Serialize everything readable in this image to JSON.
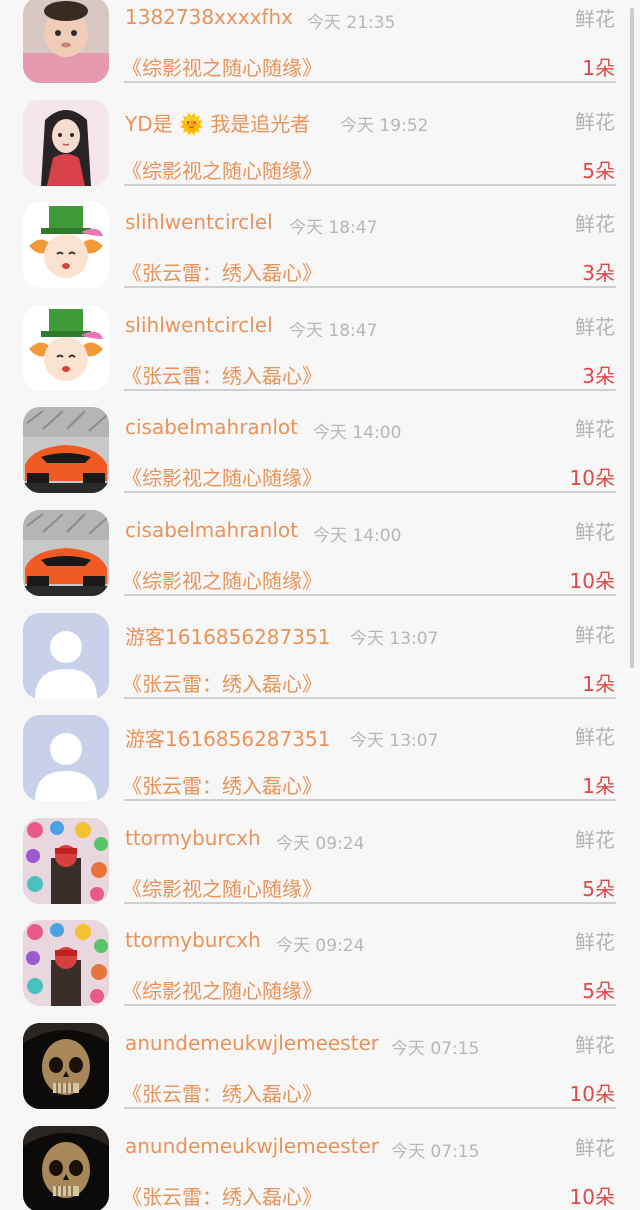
{
  "gift_records": [
    {
      "user": "1382738xxxxfhx",
      "time": "今天 21:35",
      "gift_type": "鲜花",
      "work": "《综影视之随心随缘》",
      "count": "1朵",
      "avatar": "baby-photo"
    },
    {
      "user": "YD是 🌞 我是追光者",
      "time": "今天 19:52",
      "gift_type": "鲜花",
      "work": "《综影视之随心随缘》",
      "count": "5朵",
      "avatar": "anime-girl"
    },
    {
      "user": "slihlwentcirclel",
      "time": "今天 18:47",
      "gift_type": "鲜花",
      "work": "《张云雷：绣入磊心》",
      "count": "3朵",
      "avatar": "cartoon-hatter"
    },
    {
      "user": "slihlwentcirclel",
      "time": "今天 18:47",
      "gift_type": "鲜花",
      "work": "《张云雷：绣入磊心》",
      "count": "3朵",
      "avatar": "cartoon-hatter"
    },
    {
      "user": "cisabelmahranlot",
      "time": "今天 14:00",
      "gift_type": "鲜花",
      "work": "《综影视之随心随缘》",
      "count": "10朵",
      "avatar": "orange-sports-car"
    },
    {
      "user": "cisabelmahranlot",
      "time": "今天 14:00",
      "gift_type": "鲜花",
      "work": "《综影视之随心随缘》",
      "count": "10朵",
      "avatar": "orange-sports-car"
    },
    {
      "user": "游客1616856287351",
      "time": "今天 13:07",
      "gift_type": "鲜花",
      "work": "《张云雷：绣入磊心》",
      "count": "1朵",
      "avatar": "default-silhouette"
    },
    {
      "user": "游客1616856287351",
      "time": "今天 13:07",
      "gift_type": "鲜花",
      "work": "《张云雷：绣入磊心》",
      "count": "1朵",
      "avatar": "default-silhouette"
    },
    {
      "user": "ttormyburcxh",
      "time": "今天 09:24",
      "gift_type": "鲜花",
      "work": "《综影视之随心随缘》",
      "count": "5朵",
      "avatar": "graffiti-hearts"
    },
    {
      "user": "ttormyburcxh",
      "time": "今天 09:24",
      "gift_type": "鲜花",
      "work": "《综影视之随心随缘》",
      "count": "5朵",
      "avatar": "graffiti-hearts"
    },
    {
      "user": "anundemeukwjlemeester",
      "time": "今天 07:15",
      "gift_type": "鲜花",
      "work": "《张云雷：绣入磊心》",
      "count": "10朵",
      "avatar": "skull"
    },
    {
      "user": "anundemeukwjlemeester",
      "time": "今天 07:15",
      "gift_type": "鲜花",
      "work": "《张云雷：绣入磊心》",
      "count": "10朵",
      "avatar": "skull"
    }
  ],
  "colors": {
    "username": "#e9935a",
    "timestamp": "#b7b7b7",
    "gift_type": "#b3b3b3",
    "count": "#e04848",
    "divider": "#cfcfcf",
    "background": "#f7f7f7"
  }
}
